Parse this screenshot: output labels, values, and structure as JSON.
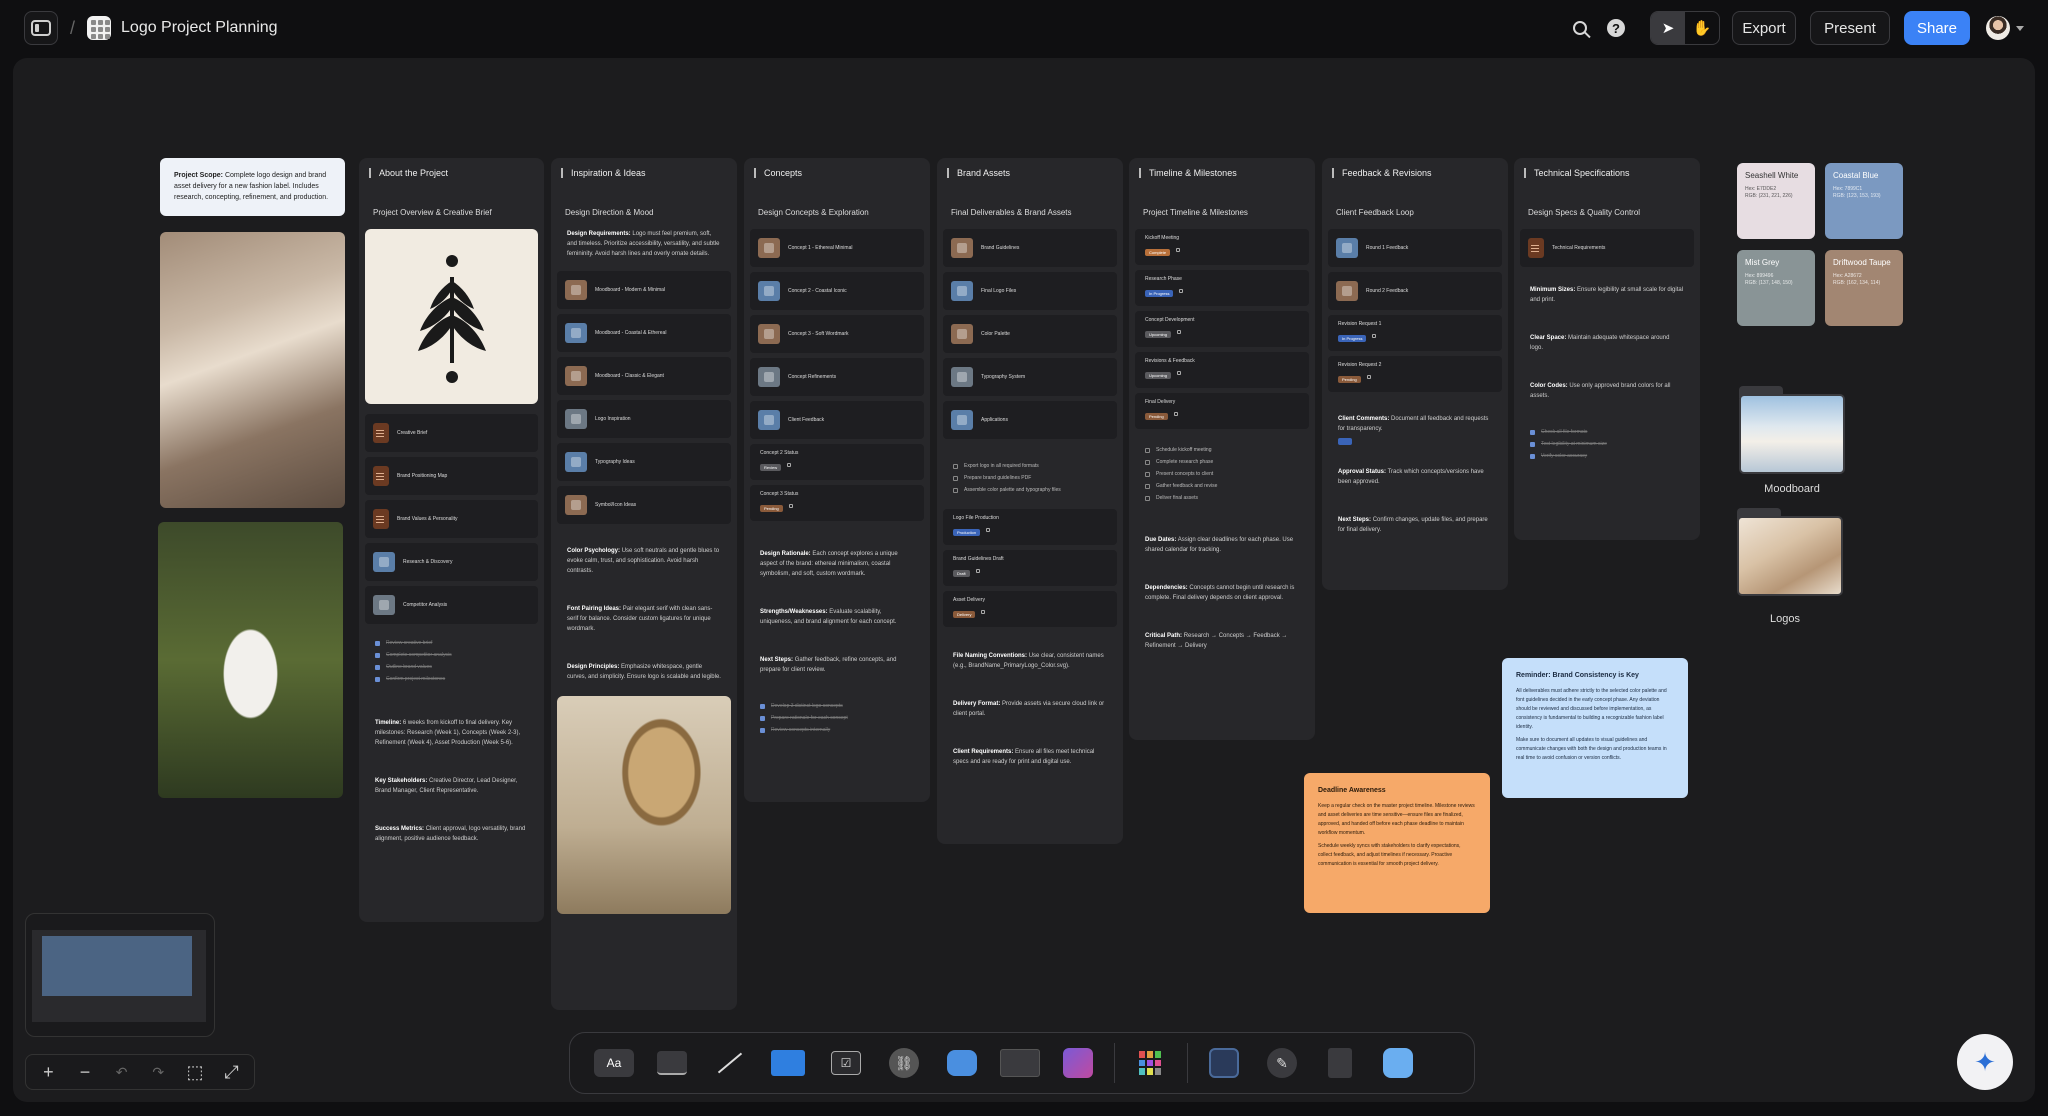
{
  "header": {
    "title": "Logo Project Planning",
    "export_label": "Export",
    "present_label": "Present",
    "share_label": "Share"
  },
  "notes": {
    "scope": {
      "bold": "Project Scope:",
      "text": "Complete logo design and brand asset delivery for a new fashion label. Includes research, concepting, refinement, and production."
    },
    "reminder": {
      "title": "Reminder: Brand Consistency is Key",
      "p1": "All deliverables must adhere strictly to the selected color palette and font guidelines decided in the early concept phase. Any deviation should be reviewed and discussed before implementation, as consistency is fundamental to building a recognizable fashion label identity.",
      "p2": "Make sure to document all updates to visual guidelines and communicate changes with both the design and production teams in real time to avoid confusion or version conflicts."
    },
    "deadline": {
      "title": "Deadline Awareness",
      "p1": "Keep a regular check on the master project timeline. Milestone reviews and asset deliveries are time sensitive—ensure files are finalized, approved, and handed off before each phase deadline to maintain workflow momentum.",
      "p2": "Schedule weekly syncs with stakeholders to clarify expectations, collect feedback, and adjust timelines if necessary. Proactive communication is essential for smooth project delivery."
    }
  },
  "columns": {
    "about": {
      "title": "About the Project",
      "subtitle": "Project Overview & Creative Brief",
      "rows": [
        "Creative Brief",
        "Brand Positioning Map",
        "Brand Values & Personality",
        "Research & Discovery",
        "Competitor Analysis"
      ],
      "checks": [
        "Review creative brief",
        "Complete competitor analysis",
        "Outline brand values",
        "Confirm project milestones"
      ],
      "paras": [
        {
          "b": "Timeline:",
          "t": "6 weeks from kickoff to final delivery. Key milestones: Research (Week 1), Concepts (Week 2-3), Refinement (Week 4), Asset Production (Week 5-6)."
        },
        {
          "b": "Key Stakeholders:",
          "t": "Creative Director, Lead Designer, Brand Manager, Client Representative."
        },
        {
          "b": "Success Metrics:",
          "t": "Client approval, logo versatility, brand alignment, positive audience feedback."
        }
      ]
    },
    "inspiration": {
      "title": "Inspiration & Ideas",
      "subtitle": "Design Direction & Mood",
      "intro": {
        "b": "Design Requirements:",
        "t": "Logo must feel premium, soft, and timeless. Prioritize accessibility, versatility, and subtle femininity. Avoid harsh lines and overly ornate details."
      },
      "rows": [
        "Moodboard - Modern & Minimal",
        "Moodboard - Coastal & Ethereal",
        "Moodboard - Classic & Elegant",
        "Logo Inspiration",
        "Typography Ideas",
        "Symbol/Icon Ideas"
      ],
      "paras": [
        {
          "b": "Color Psychology:",
          "t": "Use soft neutrals and gentle blues to evoke calm, trust, and sophistication. Avoid harsh contrasts."
        },
        {
          "b": "Font Pairing Ideas:",
          "t": "Pair elegant serif with clean sans-serif for balance. Consider custom ligatures for unique wordmark."
        },
        {
          "b": "Design Principles:",
          "t": "Emphasize whitespace, gentle curves, and simplicity. Ensure logo is scalable and legible."
        }
      ]
    },
    "concepts": {
      "title": "Concepts",
      "subtitle": "Design Concepts & Exploration",
      "rows": [
        "Concept 1 - Ethereal Minimal",
        "Concept 2 - Coastal Iconic",
        "Concept 3 - Soft Wordmark",
        "Concept Refinements",
        "Client Feedback"
      ],
      "statuses": [
        {
          "label": "Concept 2 Status",
          "pill": "Review"
        },
        {
          "label": "Concept 3 Status",
          "pill": "Pending"
        }
      ],
      "paras": [
        {
          "b": "Design Rationale:",
          "t": "Each concept explores a unique aspect of the brand: ethereal minimalism, coastal symbolism, and soft, custom wordmark."
        },
        {
          "b": "Strengths/Weaknesses:",
          "t": "Evaluate scalability, uniqueness, and brand alignment for each concept."
        },
        {
          "b": "Next Steps:",
          "t": "Gather feedback, refine concepts, and prepare for client review."
        }
      ],
      "checks": [
        "Develop 3 distinct logo concepts",
        "Prepare rationale for each concept",
        "Review concepts internally"
      ]
    },
    "brand": {
      "title": "Brand Assets",
      "subtitle": "Final Deliverables & Brand Assets",
      "rows": [
        "Brand Guidelines",
        "Final Logo Files",
        "Color Palette",
        "Typography System",
        "Applications"
      ],
      "checks": [
        "Export logo in all required formats",
        "Prepare brand guidelines PDF",
        "Assemble color palette and typography files"
      ],
      "statuses": [
        {
          "label": "Logo File Production",
          "pill": "Production"
        },
        {
          "label": "Brand Guidelines Draft",
          "pill": "Draft"
        },
        {
          "label": "Asset Delivery",
          "pill": "Delivery"
        }
      ],
      "paras": [
        {
          "b": "File Naming Conventions:",
          "t": "Use clear, consistent names (e.g., BrandName_PrimaryLogo_Color.svg)."
        },
        {
          "b": "Delivery Format:",
          "t": "Provide assets via secure cloud link or client portal."
        },
        {
          "b": "Client Requirements:",
          "t": "Ensure all files meet technical specs and are ready for print and digital use."
        }
      ]
    },
    "timeline": {
      "title": "Timeline & Milestones",
      "subtitle": "Project Timeline & Milestones",
      "statuses": [
        {
          "label": "Kickoff Meeting",
          "pill": "Complete"
        },
        {
          "label": "Research Phase",
          "pill": "In Progress"
        },
        {
          "label": "Concept Development",
          "pill": "Upcoming"
        },
        {
          "label": "Revisions & Feedback",
          "pill": "Upcoming"
        },
        {
          "label": "Final Delivery",
          "pill": "Pending"
        }
      ],
      "checks": [
        "Schedule kickoff meeting",
        "Complete research phase",
        "Present concepts to client",
        "Gather feedback and revise",
        "Deliver final assets"
      ],
      "paras": [
        {
          "b": "Due Dates:",
          "t": "Assign clear deadlines for each phase. Use shared calendar for tracking."
        },
        {
          "b": "Dependencies:",
          "t": "Concepts cannot begin until research is complete. Final delivery depends on client approval."
        },
        {
          "b": "Critical Path:",
          "t": "Research → Concepts → Feedback → Refinement → Delivery"
        }
      ]
    },
    "feedback": {
      "title": "Feedback & Revisions",
      "subtitle": "Client Feedback Loop",
      "rows": [
        "Round 1 Feedback",
        "Round 2 Feedback"
      ],
      "statuses": [
        {
          "label": "Revision Request 1",
          "pill": "In Progress"
        },
        {
          "label": "Revision Request 2",
          "pill": "Pending"
        }
      ],
      "paras": [
        {
          "b": "Client Comments:",
          "t": "Document all feedback and requests for transparency."
        },
        {
          "b": "Approval Status:",
          "t": "Track which concepts/versions have been approved."
        },
        {
          "b": "Next Steps:",
          "t": "Confirm changes, update files, and prepare for final delivery."
        }
      ]
    },
    "tech": {
      "title": "Technical Specifications",
      "subtitle": "Design Specs & Quality Control",
      "rows": [
        "Technical Requirements"
      ],
      "paras": [
        {
          "b": "Minimum Sizes:",
          "t": "Ensure legibility at small scale for digital and print."
        },
        {
          "b": "Clear Space:",
          "t": "Maintain adequate whitespace around logo."
        },
        {
          "b": "Color Codes:",
          "t": "Use only approved brand colors for all assets."
        }
      ],
      "checks": [
        "Check all file formats",
        "Test legibility at minimum size",
        "Verify color accuracy"
      ]
    }
  },
  "swatches": [
    {
      "name": "Seashell White",
      "hex": "Hex: E7DDE2",
      "rgb": "RGB: (231, 221, 226)",
      "color": "#e7dde2",
      "text": "#333333"
    },
    {
      "name": "Coastal Blue",
      "hex": "Hex: 7899C1",
      "rgb": "RGB: (123, 153, 193)",
      "color": "#7b99c1",
      "text": "#ffffff"
    },
    {
      "name": "Mist Grey",
      "hex": "Hex: 899496",
      "rgb": "RGB: (137, 148, 150)",
      "color": "#899496",
      "text": "#ffffff"
    },
    {
      "name": "Driftwood Taupe",
      "hex": "Hex: A28672",
      "rgb": "RGB: (162, 134, 114)",
      "color": "#a28672",
      "text": "#ffffff"
    }
  ],
  "folders": {
    "moodboard": "Moodboard",
    "logos": "Logos"
  },
  "dock": {
    "text_tool": "Aa"
  },
  "colors": {
    "accent": "#3b82f6",
    "reminder_bg": "#c5dffa",
    "deadline_bg": "#f6a969",
    "pill_complete": "#b8703a",
    "pill_progress": "#3a64b8",
    "pill_review": "#5a5a5e",
    "pill_pending": "#8a5a3a"
  }
}
